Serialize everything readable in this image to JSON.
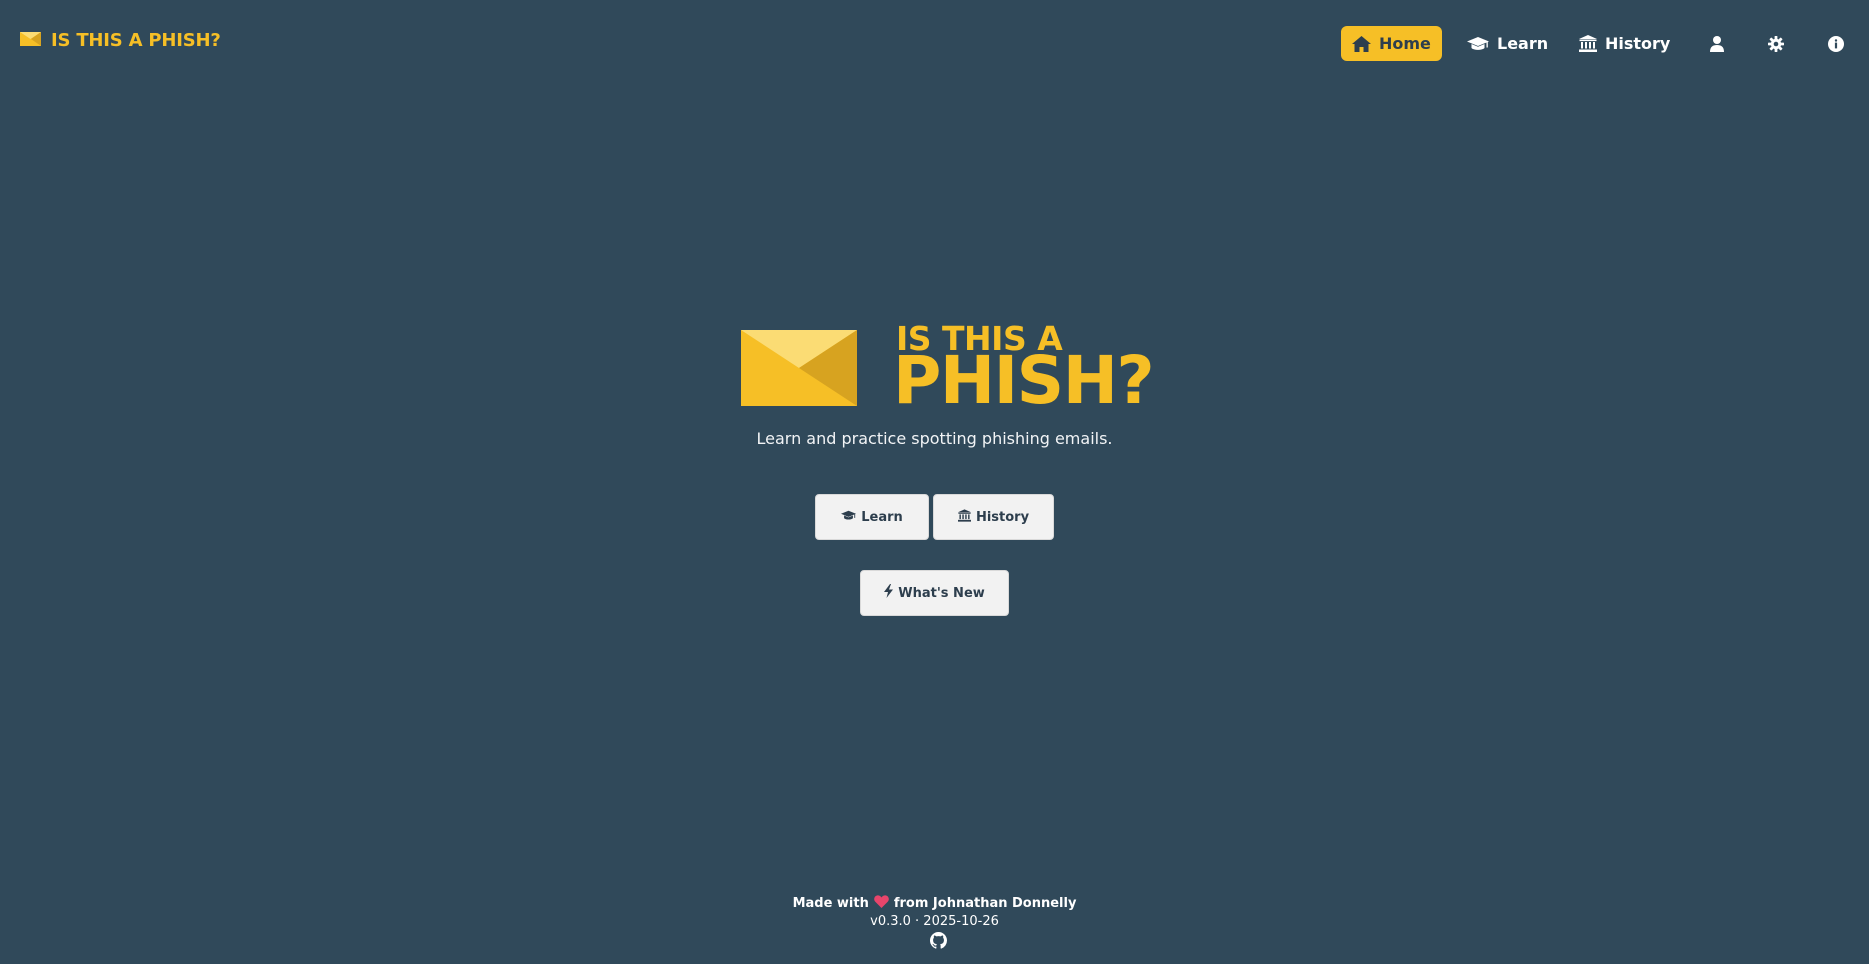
{
  "brand": {
    "title": "IS THIS A PHISH?",
    "icon": "envelope-icon"
  },
  "nav": {
    "home": "Home",
    "learn": "Learn",
    "history": "History",
    "icons": {
      "home": "home-icon",
      "learn": "graduation-cap-icon",
      "history": "landmark-icon",
      "profile": "user-icon",
      "settings": "gear-icon",
      "info": "info-icon"
    }
  },
  "hero": {
    "line1": "IS THIS A",
    "line2": "PHISH?",
    "tagline": "Learn and practice spotting phishing emails."
  },
  "actions": {
    "learn": "Learn",
    "history": "History",
    "whats_new": "What's New"
  },
  "footer": {
    "made_with": "Made with",
    "from": "from Johnathan Donnelly",
    "version": "v0.3.0 · 2025-10-26",
    "heart_icon": "heart-icon",
    "github_icon": "github-icon"
  },
  "colors": {
    "background": "#30495a",
    "accent": "#f6bf26",
    "heart": "#e8456b"
  }
}
